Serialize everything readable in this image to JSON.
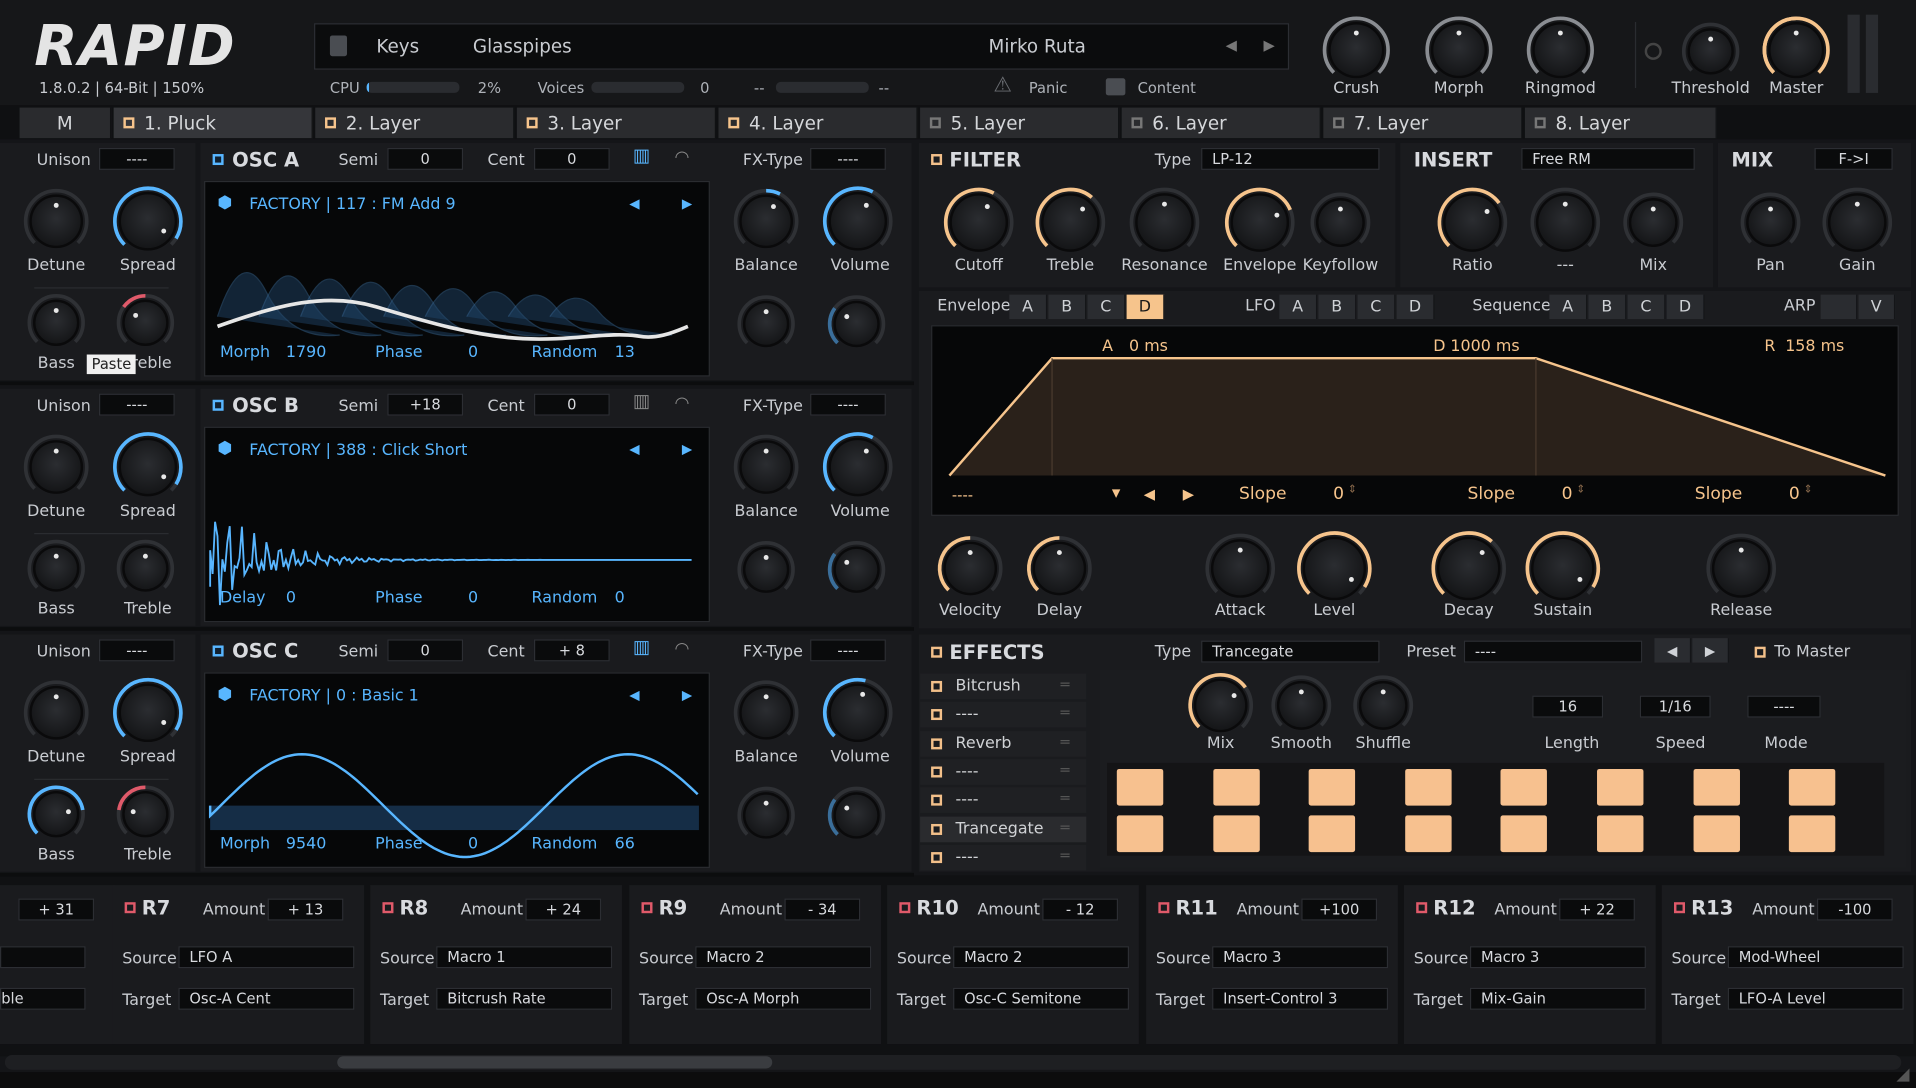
{
  "app": {
    "logo": "RAPID",
    "version": "1.8.0.2 | 64-Bit | 150%"
  },
  "preset_bar": {
    "category": "Keys",
    "name": "Glasspipes",
    "author": "Mirko Ruta"
  },
  "status": {
    "cpu_label": "CPU",
    "cpu_value": "2%",
    "cpu_level": 0.02,
    "voices_label": "Voices",
    "voices_value": "0",
    "dash1": "--",
    "dash2": "--",
    "panic": "Panic",
    "content": "Content"
  },
  "top_knobs": [
    "Crush",
    "Morph",
    "Ringmod",
    "Threshold",
    "Master"
  ],
  "tabs": [
    "M",
    "1. Pluck",
    "2. Layer",
    "3. Layer",
    "4. Layer",
    "5. Layer",
    "6. Layer",
    "7. Layer",
    "8. Layer"
  ],
  "osc": [
    {
      "title": "OSC A",
      "unison_label": "Unison",
      "unison": "----",
      "semi_label": "Semi",
      "semi": "0",
      "cent_label": "Cent",
      "cent": "0",
      "fx_label": "FX-Type",
      "fx": "----",
      "preset": "FACTORY | 117 : FM Add 9",
      "k_detune": "Detune",
      "k_spread": "Spread",
      "k_bass": "Bass",
      "k_treble": "Treble",
      "k_balance": "Balance",
      "k_volume": "Volume",
      "p1_label": "Morph",
      "p1": "1790",
      "p2_label": "Phase",
      "p2": "0",
      "p3_label": "Random",
      "p3": "13",
      "tooltip": "Paste"
    },
    {
      "title": "OSC B",
      "unison_label": "Unison",
      "unison": "----",
      "semi_label": "Semi",
      "semi": "+18",
      "cent_label": "Cent",
      "cent": "0",
      "fx_label": "FX-Type",
      "fx": "----",
      "preset": "FACTORY | 388 : Click Short",
      "k_detune": "Detune",
      "k_spread": "Spread",
      "k_bass": "Bass",
      "k_treble": "Treble",
      "k_balance": "Balance",
      "k_volume": "Volume",
      "p1_label": "Delay",
      "p1": "0",
      "p2_label": "Phase",
      "p2": "0",
      "p3_label": "Random",
      "p3": "0"
    },
    {
      "title": "OSC C",
      "unison_label": "Unison",
      "unison": "----",
      "semi_label": "Semi",
      "semi": "0",
      "cent_label": "Cent",
      "cent": "+ 8",
      "fx_label": "FX-Type",
      "fx": "----",
      "preset": "FACTORY | 0 : Basic 1",
      "k_detune": "Detune",
      "k_spread": "Spread",
      "k_bass": "Bass",
      "k_treble": "Treble",
      "k_balance": "Balance",
      "k_volume": "Volume",
      "p1_label": "Morph",
      "p1": "9540",
      "p2_label": "Phase",
      "p2": "0",
      "p3_label": "Random",
      "p3": "66"
    }
  ],
  "filter": {
    "title": "FILTER",
    "type_label": "Type",
    "type": "LP-12",
    "knobs": [
      "Cutoff",
      "Treble",
      "Resonance",
      "Envelope",
      "Keyfollow"
    ]
  },
  "insert": {
    "title": "INSERT",
    "type": "Free RM",
    "knobs": [
      "Ratio",
      "---",
      "Mix"
    ]
  },
  "mix": {
    "title": "MIX",
    "mode": "F->I",
    "knobs": [
      "Pan",
      "Gain"
    ]
  },
  "mod_tabs": {
    "envelope": "Envelope",
    "lfo": "LFO",
    "sequence": "Sequence",
    "arp": "ARP",
    "letters": [
      "A",
      "B",
      "C",
      "D"
    ],
    "arp_v": "V"
  },
  "envelope": {
    "a_label": "A",
    "a": "0 ms",
    "d_label": "D",
    "d": "1000 ms",
    "r_label": "R",
    "r": "158 ms",
    "select": "----",
    "slope_label": "Slope",
    "slope1": "0",
    "slope2": "0",
    "slope3": "0",
    "knobs": [
      "Velocity",
      "Delay",
      "Attack",
      "Level",
      "Decay",
      "Sustain",
      "Release"
    ]
  },
  "effects": {
    "title": "EFFECTS",
    "type_label": "Type",
    "type": "Trancegate",
    "preset_label": "Preset",
    "preset": "----",
    "to_master": "To Master",
    "slots": [
      "Bitcrush",
      "----",
      "Reverb",
      "----",
      "----",
      "Trancegate",
      "----"
    ],
    "knobs": [
      "Mix",
      "Smooth",
      "Shuffle"
    ],
    "length_label": "Length",
    "length": "16",
    "speed_label": "Speed",
    "speed": "1/16",
    "mode_label": "Mode",
    "mode": "----"
  },
  "routes": [
    {
      "name": "",
      "amount": "+ 31",
      "source": "",
      "target": "ble"
    },
    {
      "name": "R7",
      "amount": "+ 13",
      "source": "LFO A",
      "target": "Osc-A Cent"
    },
    {
      "name": "R8",
      "amount": "+ 24",
      "source": "Macro 1",
      "target": "Bitcrush Rate"
    },
    {
      "name": "R9",
      "amount": "- 34",
      "source": "Macro 2",
      "target": "Osc-A Morph"
    },
    {
      "name": "R10",
      "amount": "- 12",
      "source": "Macro 2",
      "target": "Osc-C Semitone"
    },
    {
      "name": "R11",
      "amount": "+100",
      "source": "Macro 3",
      "target": "Insert-Control 3"
    },
    {
      "name": "R12",
      "amount": "+ 22",
      "source": "Macro 3",
      "target": "Mix-Gain"
    },
    {
      "name": "R13",
      "amount": "-100",
      "source": "Mod-Wheel",
      "target": "LFO-A Level"
    }
  ],
  "route_labels": {
    "amount": "Amount",
    "source": "Source",
    "target": "Target"
  },
  "colors": {
    "accent_orange": "#f6c48c",
    "accent_blue": "#58b6ff",
    "background": "#141518"
  }
}
